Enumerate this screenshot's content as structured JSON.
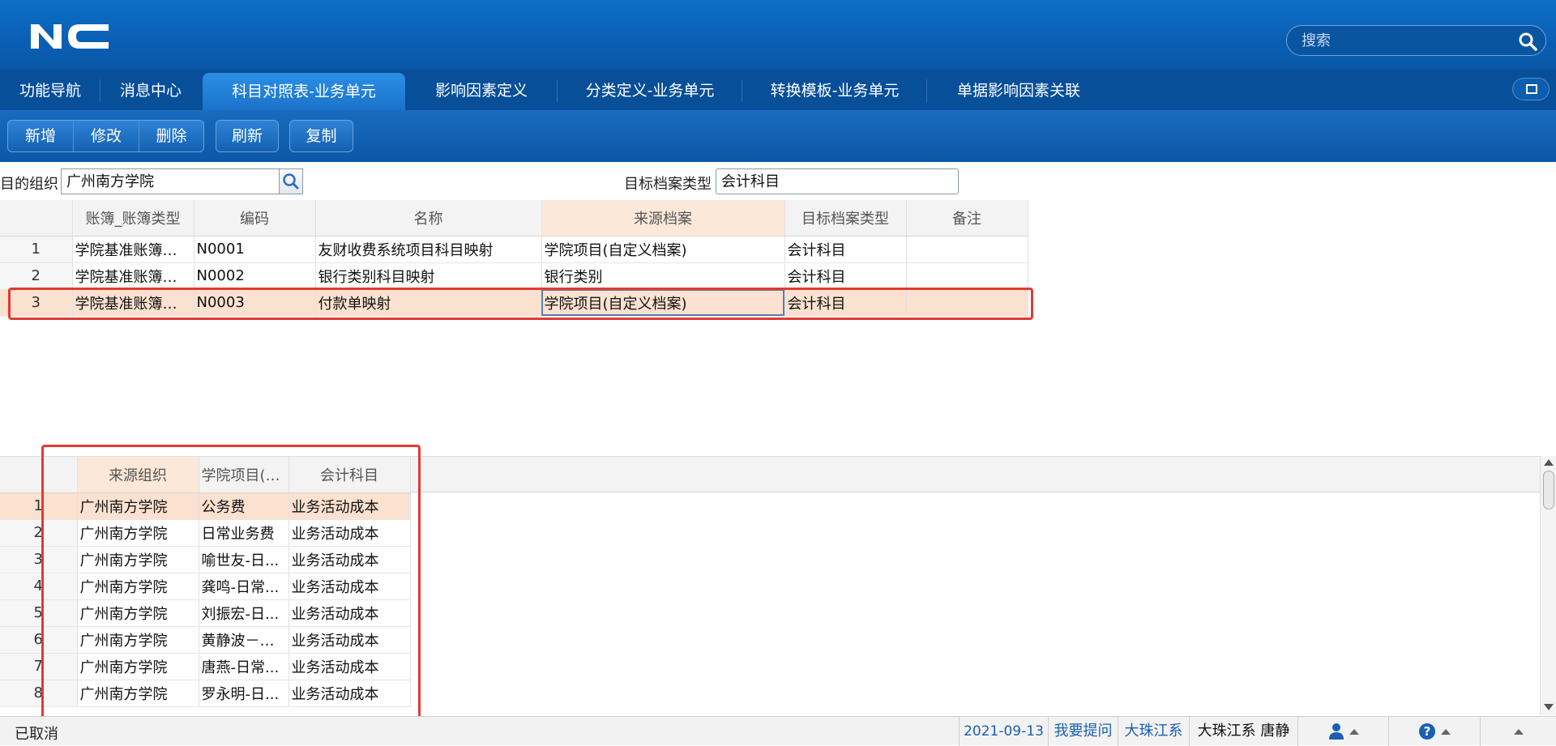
{
  "header": {
    "logo_text": "NC",
    "search_placeholder": "搜索",
    "brand_color": "#0a5fb3"
  },
  "tabs": [
    {
      "label": "功能导航",
      "active": false
    },
    {
      "label": "消息中心",
      "active": false
    },
    {
      "label": "科目对照表-业务单元",
      "active": true
    },
    {
      "label": "影响因素定义",
      "active": false
    },
    {
      "label": "分类定义-业务单元",
      "active": false
    },
    {
      "label": "转换模板-业务单元",
      "active": false
    },
    {
      "label": "单据影响因素关联",
      "active": false
    }
  ],
  "toolbar": {
    "add_label": "新增",
    "edit_label": "修改",
    "delete_label": "删除",
    "refresh_label": "刷新",
    "copy_label": "复制"
  },
  "filter": {
    "target_org_label": "目的组织",
    "target_org_value": "广州南方学院",
    "target_type_label": "目标档案类型",
    "target_type_value": "会计科目"
  },
  "main_table": {
    "headers": [
      "",
      "账簿_账簿类型",
      "编码",
      "名称",
      "来源档案",
      "目标档案类型",
      "备注"
    ],
    "rows": [
      {
        "no": "1",
        "book": "学院基准账簿类...",
        "code": "N0001",
        "name": "友财收费系统项目科目映射",
        "source": "学院项目(自定义档案)",
        "target": "会计科目",
        "note": ""
      },
      {
        "no": "2",
        "book": "学院基准账簿类...",
        "code": "N0002",
        "name": "银行类别科目映射",
        "source": "银行类别",
        "target": "会计科目",
        "note": ""
      },
      {
        "no": "3",
        "book": "学院基准账簿类...",
        "code": "N0003",
        "name": "付款单映射",
        "source": "学院项目(自定义档案)",
        "target": "会计科目",
        "note": ""
      }
    ],
    "selected_row": 3
  },
  "detail_table": {
    "headers": [
      "",
      "来源组织",
      "学院项目(自...",
      "会计科目"
    ],
    "rows": [
      {
        "no": "1",
        "org": "广州南方学院",
        "item": "公务费",
        "account": "业务活动成本"
      },
      {
        "no": "2",
        "org": "广州南方学院",
        "item": "日常业务费",
        "account": "业务活动成本"
      },
      {
        "no": "3",
        "org": "广州南方学院",
        "item": "喻世友-日...",
        "account": "业务活动成本"
      },
      {
        "no": "4",
        "org": "广州南方学院",
        "item": "龚鸣-日常...",
        "account": "业务活动成本"
      },
      {
        "no": "5",
        "org": "广州南方学院",
        "item": "刘振宏-日...",
        "account": "业务活动成本"
      },
      {
        "no": "6",
        "org": "广州南方学院",
        "item": "黄静波－日...",
        "account": "业务活动成本"
      },
      {
        "no": "7",
        "org": "广州南方学院",
        "item": "唐燕-日常...",
        "account": "业务活动成本"
      },
      {
        "no": "8",
        "org": "广州南方学院",
        "item": "罗永明-日...",
        "account": "业务活动成本"
      }
    ],
    "selected_row": 1
  },
  "status": {
    "message": "已取消",
    "date": "2021-09-13",
    "help_link": "我要提问",
    "org_link": "大珠江系",
    "user": "大珠江系 唐静"
  },
  "colors": {
    "selection": "#fbe1cf",
    "highlight_header": "#fce8d9",
    "annotation_red": "#e23a32",
    "link": "#1a5fb4"
  }
}
